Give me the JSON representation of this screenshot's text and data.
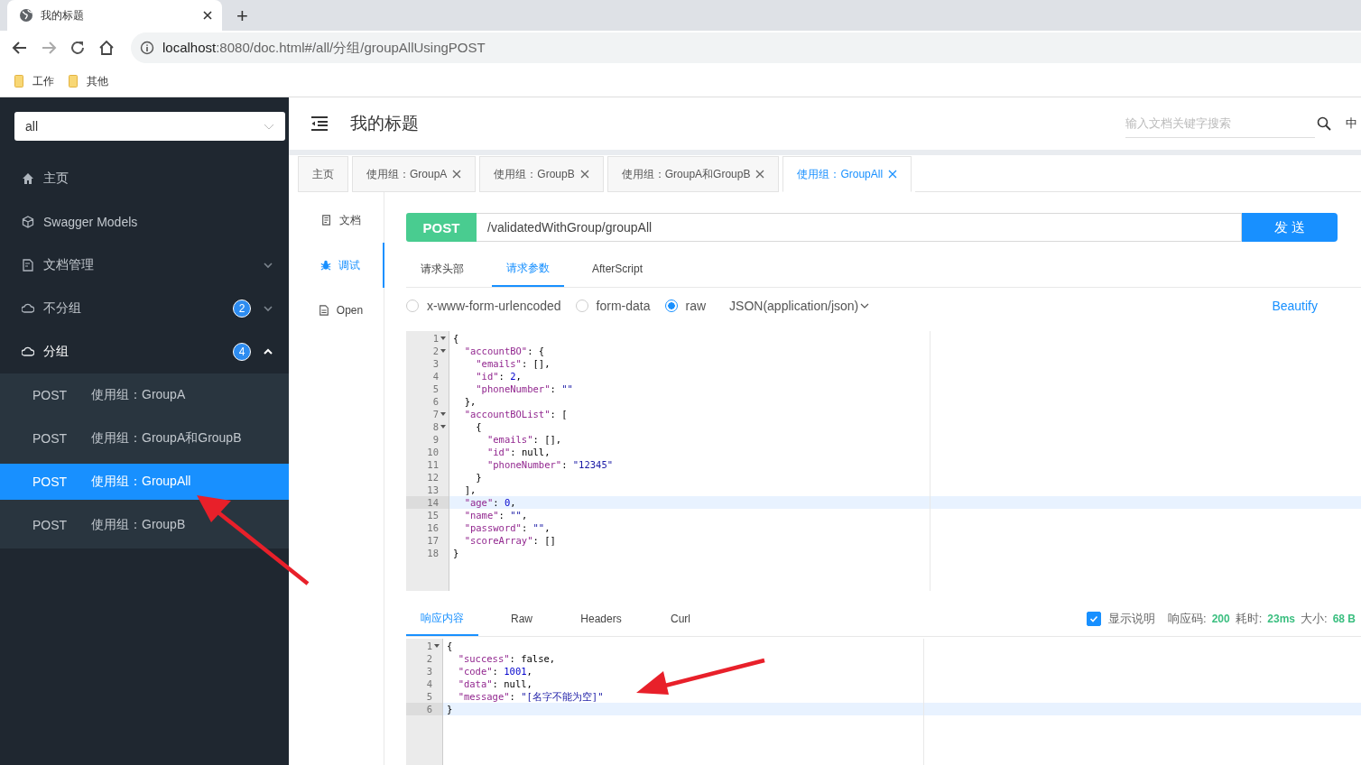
{
  "browser": {
    "tab_title": "我的标题",
    "new_tab": "+",
    "url_host": "localhost",
    "url_rest": ":8080/doc.html#/all/分组/groupAllUsingPOST",
    "bookmarks": [
      "工作",
      "其他"
    ]
  },
  "sidebar": {
    "group_select": "all",
    "items": [
      {
        "label": "主页"
      },
      {
        "label": "Swagger Models"
      },
      {
        "label": "文档管理",
        "expanded": false
      },
      {
        "label": "不分组",
        "badge": "2",
        "expanded": false
      },
      {
        "label": "分组",
        "badge": "4",
        "expanded": true,
        "children": [
          {
            "method": "POST",
            "label": "使用组：GroupA",
            "selected": false
          },
          {
            "method": "POST",
            "label": "使用组：GroupA和GroupB",
            "selected": false
          },
          {
            "method": "POST",
            "label": "使用组：GroupAll",
            "selected": true
          },
          {
            "method": "POST",
            "label": "使用组：GroupB",
            "selected": false
          }
        ]
      }
    ]
  },
  "header": {
    "title": "我的标题",
    "search_placeholder": "输入文档关键字搜索",
    "language": "中"
  },
  "tabs": [
    {
      "label": "主页",
      "closable": false,
      "selected": false
    },
    {
      "label": "使用组：GroupA",
      "closable": true,
      "selected": false
    },
    {
      "label": "使用组：GroupB",
      "closable": true,
      "selected": false
    },
    {
      "label": "使用组：GroupA和GroupB",
      "closable": true,
      "selected": false
    },
    {
      "label": "使用组：GroupAll",
      "closable": true,
      "selected": true
    }
  ],
  "side_nav": [
    {
      "label": "文档",
      "selected": false
    },
    {
      "label": "调试",
      "selected": true
    },
    {
      "label": "Open",
      "selected": false
    }
  ],
  "request": {
    "method": "POST",
    "path": "/validatedWithGroup/groupAll",
    "send": "发 送"
  },
  "request_tabs": [
    {
      "label": "请求头部",
      "selected": false
    },
    {
      "label": "请求参数",
      "selected": true
    },
    {
      "label": "AfterScript",
      "selected": false
    }
  ],
  "body_types": [
    {
      "label": "x-www-form-urlencoded",
      "selected": false
    },
    {
      "label": "form-data",
      "selected": false
    },
    {
      "label": "raw",
      "selected": true
    }
  ],
  "content_type": "JSON(application/json)",
  "beautify": "Beautify",
  "request_body": [
    {
      "number": "1",
      "text": "{",
      "fold": true,
      "active": false
    },
    {
      "number": "2",
      "text": "  \"accountBO\": {",
      "fold": true,
      "active": false
    },
    {
      "number": "3",
      "text": "    \"emails\": [],",
      "fold": false,
      "active": false
    },
    {
      "number": "4",
      "text": "    \"id\": 2,",
      "fold": false,
      "active": false
    },
    {
      "number": "5",
      "text": "    \"phoneNumber\": \"\"",
      "fold": false,
      "active": false
    },
    {
      "number": "6",
      "text": "  },",
      "fold": false,
      "active": false
    },
    {
      "number": "7",
      "text": "  \"accountBOList\": [",
      "fold": true,
      "active": false
    },
    {
      "number": "8",
      "text": "    {",
      "fold": true,
      "active": false
    },
    {
      "number": "9",
      "text": "      \"emails\": [],",
      "fold": false,
      "active": false
    },
    {
      "number": "10",
      "text": "      \"id\": null,",
      "fold": false,
      "active": false
    },
    {
      "number": "11",
      "text": "      \"phoneNumber\": \"12345\"",
      "fold": false,
      "active": false
    },
    {
      "number": "12",
      "text": "    }",
      "fold": false,
      "active": false
    },
    {
      "number": "13",
      "text": "  ],",
      "fold": false,
      "active": false
    },
    {
      "number": "14",
      "text": "  \"age\": 0,",
      "fold": false,
      "active": true
    },
    {
      "number": "15",
      "text": "  \"name\": \"\",",
      "fold": false,
      "active": false
    },
    {
      "number": "16",
      "text": "  \"password\": \"\",",
      "fold": false,
      "active": false
    },
    {
      "number": "17",
      "text": "  \"scoreArray\": []",
      "fold": false,
      "active": false
    },
    {
      "number": "18",
      "text": "}",
      "fold": false,
      "active": false
    }
  ],
  "response_tabs": [
    {
      "label": "响应内容",
      "selected": true
    },
    {
      "label": "Raw",
      "selected": false
    },
    {
      "label": "Headers",
      "selected": false
    },
    {
      "label": "Curl",
      "selected": false
    }
  ],
  "response_status": {
    "show_description": {
      "label": "显示说明",
      "checked": true
    },
    "items": [
      {
        "label": "响应码:",
        "value": "200"
      },
      {
        "label": "耗时:",
        "value": "23ms"
      },
      {
        "label": "大小:",
        "value": "68 B"
      }
    ]
  },
  "response_body": [
    {
      "number": "1",
      "text": "{",
      "fold": true,
      "active": false
    },
    {
      "number": "2",
      "text": "  \"success\": false,",
      "fold": false,
      "active": false
    },
    {
      "number": "3",
      "text": "  \"code\": 1001,",
      "fold": false,
      "active": false
    },
    {
      "number": "4",
      "text": "  \"data\": null,",
      "fold": false,
      "active": false
    },
    {
      "number": "5",
      "text": "  \"message\": \"[名字不能为空]\"",
      "fold": false,
      "active": false
    },
    {
      "number": "6",
      "text": "}",
      "fold": false,
      "active": true
    }
  ],
  "annotations": [
    {
      "kind": "arrow"
    },
    {
      "kind": "arrow"
    }
  ]
}
